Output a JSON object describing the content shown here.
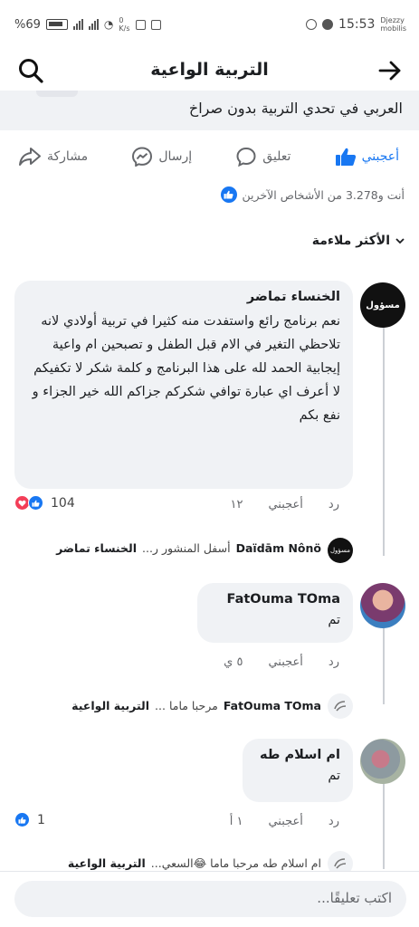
{
  "status_bar": {
    "time": "15:53",
    "carrier": [
      "Djezzy",
      "mobilis"
    ],
    "battery": "%69",
    "net_speed": [
      "0",
      "K/s"
    ]
  },
  "header": {
    "title": "التربية الواعية"
  },
  "post": {
    "snippet": "العربي في تحدي التربية بدون صراخ"
  },
  "actions": {
    "like": "أعجبني",
    "comment": "تعليق",
    "send": "إرسال",
    "share": "مشاركة"
  },
  "reactors": "أنت و3.278 من الأشخاص الآخرين",
  "sort_label": "الأكثر ملاءمة",
  "comments": [
    {
      "author": "الخنساء تماضر",
      "avatar_label": "مسؤول",
      "text": "نعم برنامج رائع واستفدت منه كثيرا في تربية أولادي لانه تلاحظي التغير في الام قبل الطفل و تصبحين ام واعية إيجابية الحمد لله على هذا البرنامج و كلمة شكر لا تكفيكم لا أعرف اي عبارة توافي شكركم جزاكم الله خير الجزاء و نفع بكم",
      "time": "١٢",
      "like_label": "أعجبني",
      "reply_label": "رد",
      "reactions": "104",
      "reply_preview": {
        "author": "الخنساء تماضر",
        "text": "أسفل المنشور ر...",
        "mention": "Daïdām Nônö"
      }
    },
    {
      "author": "FatOuma TOma",
      "text": "تم",
      "time": "٥ ي",
      "like_label": "أعجبني",
      "reply_label": "رد",
      "reply_preview": {
        "author": "التربية الواعية",
        "text": "مرحبا ماما ...",
        "mention": "FatOuma TOma"
      }
    },
    {
      "author": "ام اسلام طه",
      "text": "تم",
      "time": "١ أ",
      "like_label": "أعجبني",
      "reply_label": "رد",
      "reactions": "1",
      "reply_preview": {
        "author": "التربية الواعية",
        "text": "ام اسلام طه مرحبا ماما 😂السعي...",
        "mention": ""
      }
    }
  ],
  "composer": {
    "placeholder": "اكتب تعليقًا..."
  },
  "colors": {
    "accent": "#1877f2",
    "bubble": "#f0f2f5",
    "muted": "#65676b",
    "love": "#f33e58"
  }
}
